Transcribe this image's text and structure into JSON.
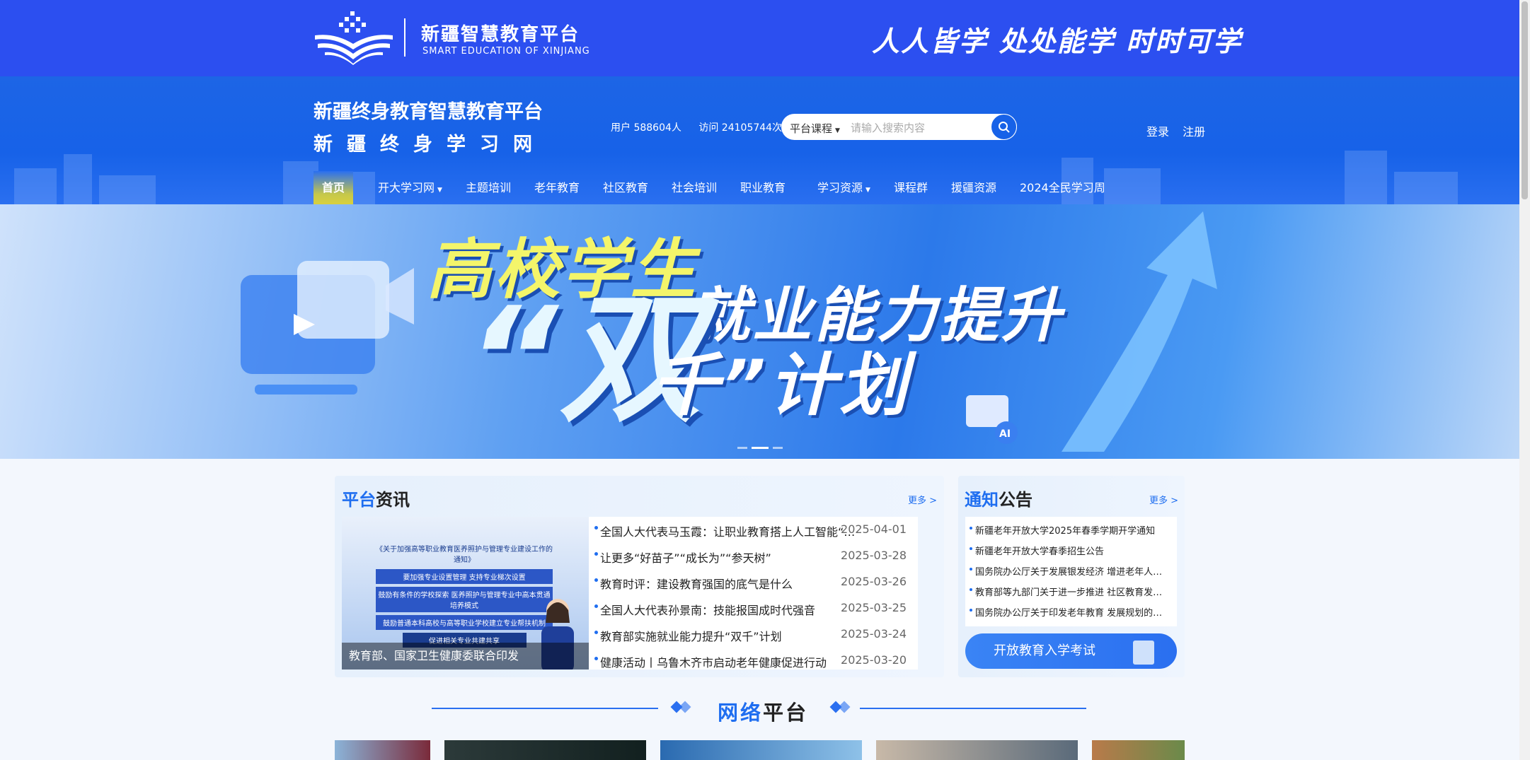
{
  "topbar": {
    "logo_title": "新疆智慧教育平台",
    "logo_subtitle": "SMART EDUCATION OF XINJIANG",
    "slogan": "人人皆学 处处能学 时时可学"
  },
  "header": {
    "site_name_1": "新疆终身教育智慧教育平台",
    "site_name_2": "新疆终身学习网",
    "stats": {
      "users": "用户 588604人",
      "visits": "访问 24105744次"
    },
    "search": {
      "category": "平台课程",
      "placeholder": "请输入搜索内容"
    },
    "auth": {
      "login": "登录",
      "register": "注册"
    }
  },
  "nav": [
    {
      "label": "首页",
      "active": true
    },
    {
      "label": "开大学习网",
      "dropdown": true
    },
    {
      "label": "主题培训"
    },
    {
      "label": "老年教育"
    },
    {
      "label": "社区教育"
    },
    {
      "label": "社会培训"
    },
    {
      "label": "职业教育"
    },
    {
      "label": "学习资源",
      "dropdown": true
    },
    {
      "label": "课程群"
    },
    {
      "label": "援疆资源"
    },
    {
      "label": "2024全民学习周"
    }
  ],
  "banner": {
    "line1": "高校学生",
    "line2": "就业能力提升",
    "line3_big": "“双",
    "line3_rest": "千”计划"
  },
  "news": {
    "title_blue": "平台",
    "title_rest": "资讯",
    "more": "更多 >",
    "image_caption": "教育部、国家卫生健康委联合印发",
    "image_board": [
      "《关于加强高等职业教育医养照护与管理专业建设工作的通知》",
      "要加强专业设置管理 支持专业梯次设置",
      "鼓励有条件的学校探索 医养照护与管理专业中高本贯通培养模式",
      "鼓励普通本科高校与高等职业学校建立专业帮扶机制",
      "促进相关专业共建共享"
    ],
    "items": [
      {
        "title": "全国人大代表马玉霞：让职业教育搭上人工智能“快车”",
        "date": "2025-04-01"
      },
      {
        "title": "让更多“好苗子”“成长为”“参天树”",
        "date": "2025-03-28"
      },
      {
        "title": "教育时评：建设教育强国的底气是什么",
        "date": "2025-03-26"
      },
      {
        "title": "全国人大代表孙景南：技能报国成时代强音",
        "date": "2025-03-25"
      },
      {
        "title": "教育部实施就业能力提升“双千”计划",
        "date": "2025-03-24"
      },
      {
        "title": "健康活动丨乌鲁木齐市启动老年健康促进行动",
        "date": "2025-03-20"
      }
    ]
  },
  "notice": {
    "title_blue": "通知",
    "title_rest": "公告",
    "more": "更多 >",
    "items": [
      "新疆老年开放大学2025年春季学期开学通知",
      "新疆老年开放大学春季招生公告",
      "国务院办公厅关于发展银发经济 增进老年人福祉的意见",
      "教育部等九部门关于进一步推进 社区教育发展的意见",
      "国务院办公厅关于印发老年教育 发展规划的通知"
    ],
    "exam_button": "开放教育入学考试"
  },
  "network": {
    "title_blue": "网络",
    "title_rest": "平台"
  },
  "colors": {
    "topbar": "#2c4ff0",
    "header": "#1762e8",
    "accent": "#1f6ef0",
    "nav_active": "#d9d03e"
  }
}
